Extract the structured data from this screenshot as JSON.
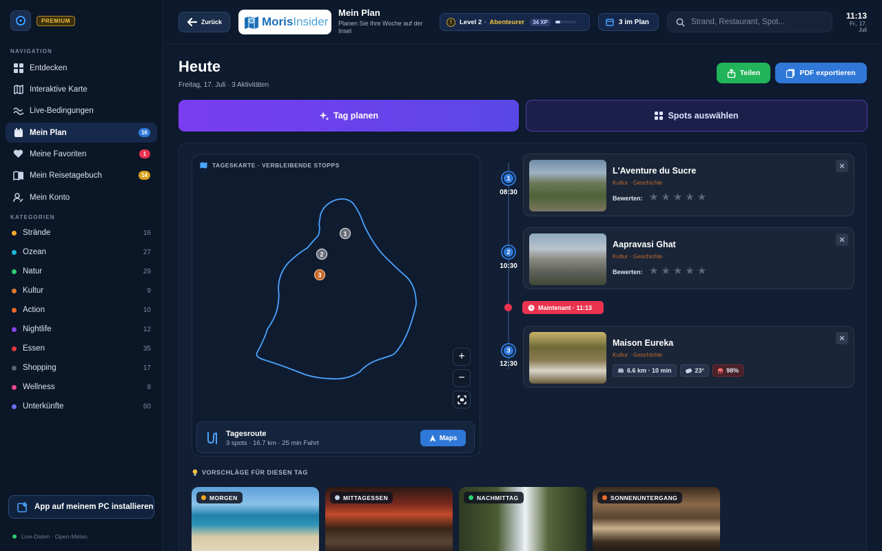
{
  "sidebar": {
    "premium": "PREMIUM",
    "nav_title": "NAVIGATION",
    "nav": [
      {
        "label": "Entdecken",
        "icon": "grid-icon"
      },
      {
        "label": "Interaktive Karte",
        "icon": "map-icon"
      },
      {
        "label": "Live-Bedingungen",
        "icon": "waves-icon"
      },
      {
        "label": "Mein Plan",
        "icon": "calendar-icon",
        "badge": "16",
        "badge_color": "#2f78d8"
      },
      {
        "label": "Meine Favoriten",
        "icon": "heart-icon",
        "badge": "1",
        "badge_color": "#e9334f"
      },
      {
        "label": "Mein Reisetagebuch",
        "icon": "book-icon",
        "badge": "14",
        "badge_color": "#d9a21b"
      },
      {
        "label": "Mein Konto",
        "icon": "user-icon"
      }
    ],
    "cat_title": "KATEGORIEN",
    "categories": [
      {
        "label": "Strände",
        "count": "16",
        "color": "#f5a623"
      },
      {
        "label": "Ozean",
        "count": "27",
        "color": "#1fb6d6"
      },
      {
        "label": "Natur",
        "count": "29",
        "color": "#2ecc71"
      },
      {
        "label": "Kultur",
        "count": "9",
        "color": "#e07a2e"
      },
      {
        "label": "Action",
        "count": "10",
        "color": "#f06a2a"
      },
      {
        "label": "Nightlife",
        "count": "12",
        "color": "#8b45e6"
      },
      {
        "label": "Essen",
        "count": "35",
        "color": "#e5393f"
      },
      {
        "label": "Shopping",
        "count": "17",
        "color": "#5a6478"
      },
      {
        "label": "Wellness",
        "count": "8",
        "color": "#e64a8c"
      },
      {
        "label": "Unterkünfte",
        "count": "60",
        "color": "#6a6ff0"
      }
    ],
    "install": "App auf meinem PC installieren",
    "live_data": "Live-Daten · Open-Meteo"
  },
  "header": {
    "back": "Zurück",
    "brand_a": "Moris",
    "brand_b": "Insider",
    "plan_title": "Mein Plan",
    "plan_sub": "Planen Sie Ihre Woche auf der Insel",
    "level": "Level 2",
    "level_sep": "·",
    "level_name": "Abenteurer",
    "xp": "34 XP",
    "xp_progress": 0.25,
    "in_plan": "3 im Plan",
    "search_placeholder": "Strand, Restaurant, Spot...",
    "time": "11:13",
    "date": "Fr., 17. Juli"
  },
  "main": {
    "title": "Heute",
    "subtitle": "Freitag, 17. Juli · 3 Aktivitäten",
    "share": "Teilen",
    "pdf": "PDF exportieren",
    "tab_plan": "Tag planen",
    "tab_spots": "Spots auswählen",
    "map_label": "TAGESKARTE · VERBLEIBENDE STOPPS",
    "route_title": "Tagesroute",
    "route_sub": "3 spots · 16.7 km · 25 min Fahrt",
    "maps": "Maps",
    "now": "Maintenant · 11:13",
    "stops": [
      {
        "num": "1",
        "time": "08:30",
        "name": "L'Aventure du Sucre",
        "cat": "Kultur · Geschichte",
        "rate": "Bewerten:"
      },
      {
        "num": "2",
        "time": "10:30",
        "name": "Aapravasi Ghat",
        "cat": "Kultur · Geschichte",
        "rate": "Bewerten:"
      },
      {
        "num": "3",
        "time": "12:30",
        "name": "Maison Eureka",
        "cat": "Kultur · Geschichte",
        "distance": "6.6 km · 10 min",
        "temp": "23°",
        "humidity": "98%"
      }
    ],
    "sugg_label": "VORSCHLÄGE FÜR DIESEN TAG",
    "suggestions": [
      {
        "tag": "MORGEN",
        "color": "#f5a623"
      },
      {
        "tag": "MITTAGESSEN",
        "color": "#c9d4e6"
      },
      {
        "tag": "NACHMITTAG",
        "color": "#2ecc71"
      },
      {
        "tag": "SONNENUNTERGANG",
        "color": "#f06a2a"
      }
    ]
  }
}
